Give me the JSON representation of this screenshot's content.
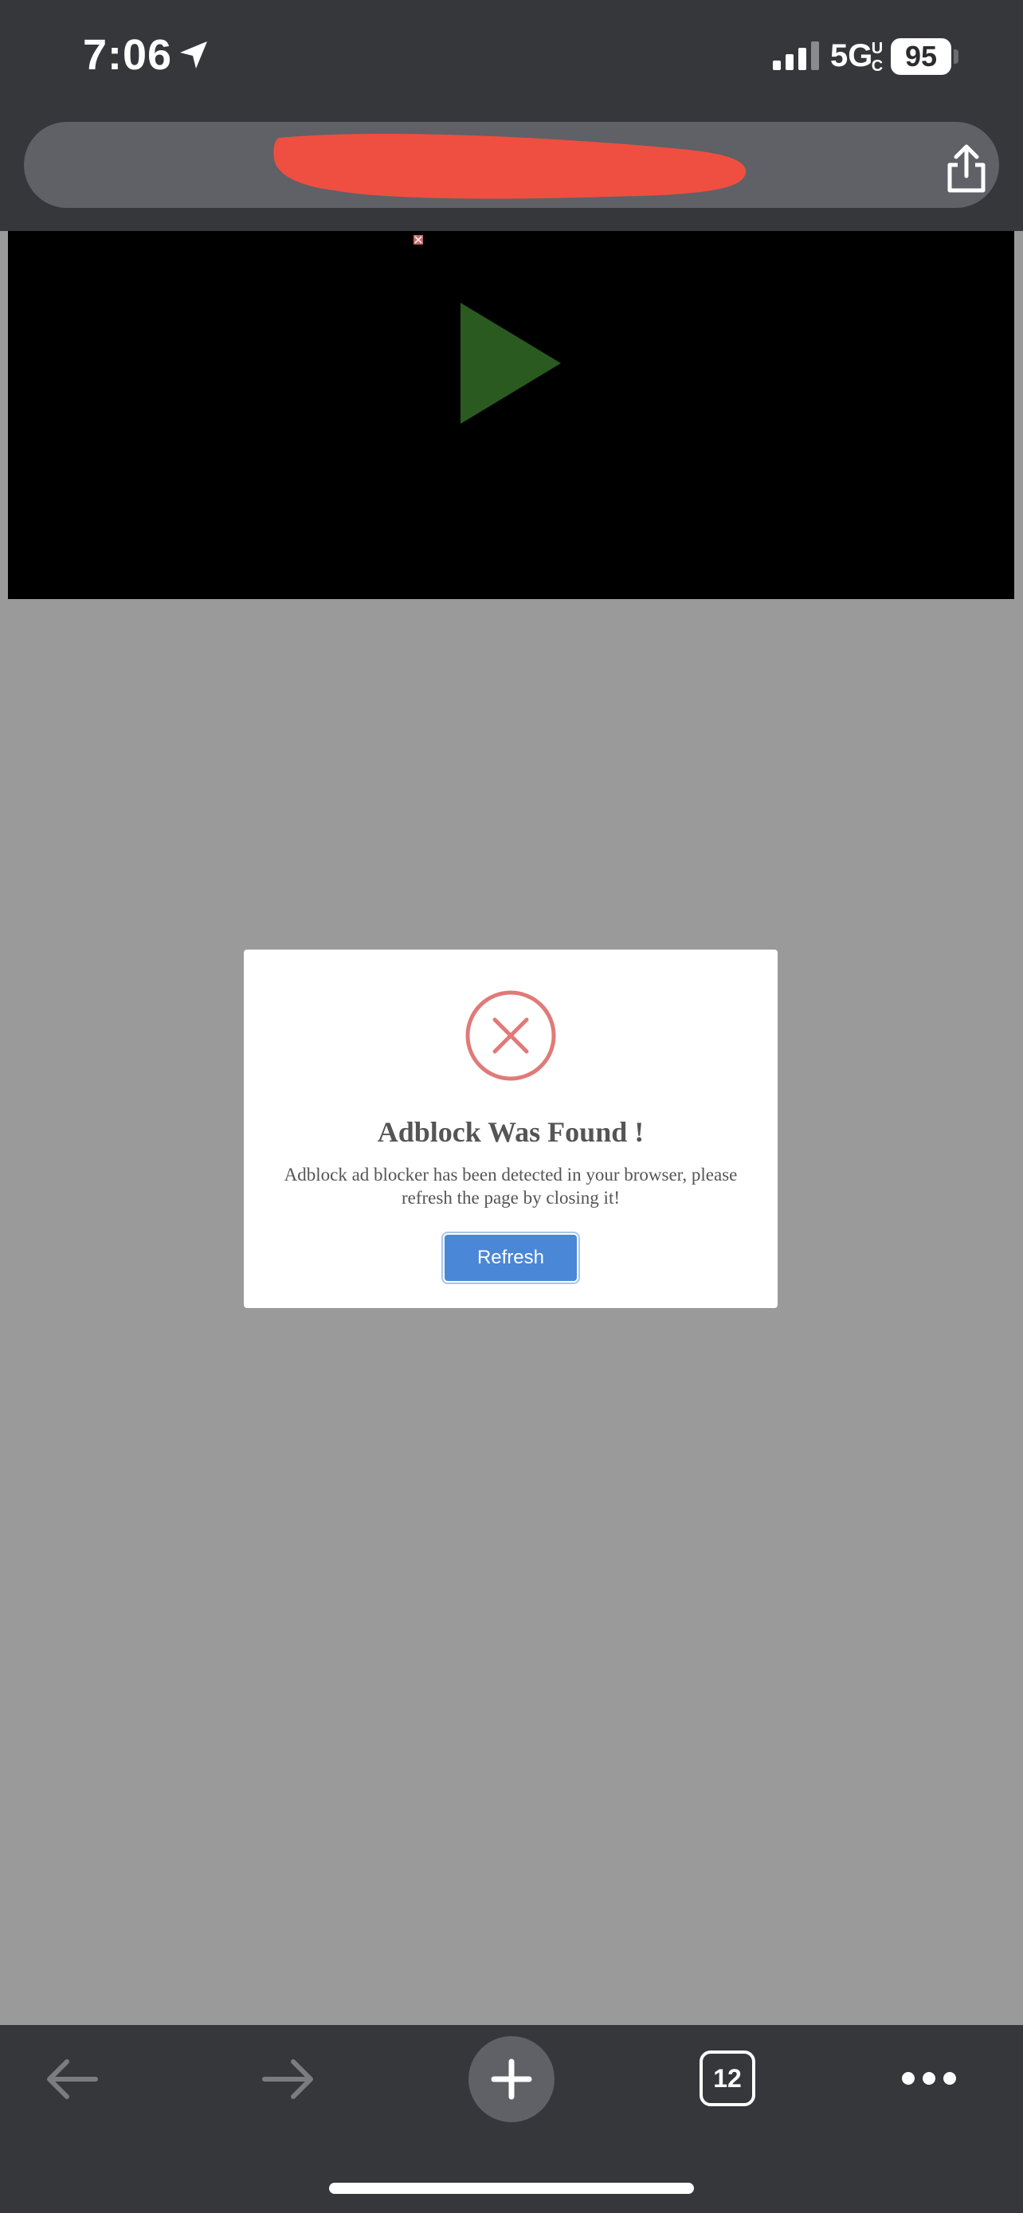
{
  "status_bar": {
    "time": "7:06",
    "network": "5G",
    "network_suffix": "UC",
    "battery": "95"
  },
  "dialog": {
    "title": "Adblock Was Found !",
    "message": "Adblock ad blocker has been detected in your browser, please refresh the page by closing it!",
    "button_label": "Refresh"
  },
  "toolbar": {
    "tab_count": "12"
  },
  "colors": {
    "chrome_bg": "#36373a",
    "page_overlay": "#9a9a9a",
    "error_red": "#e07a78",
    "button_blue": "#4a87d6",
    "play_green": "#2a5a20"
  }
}
